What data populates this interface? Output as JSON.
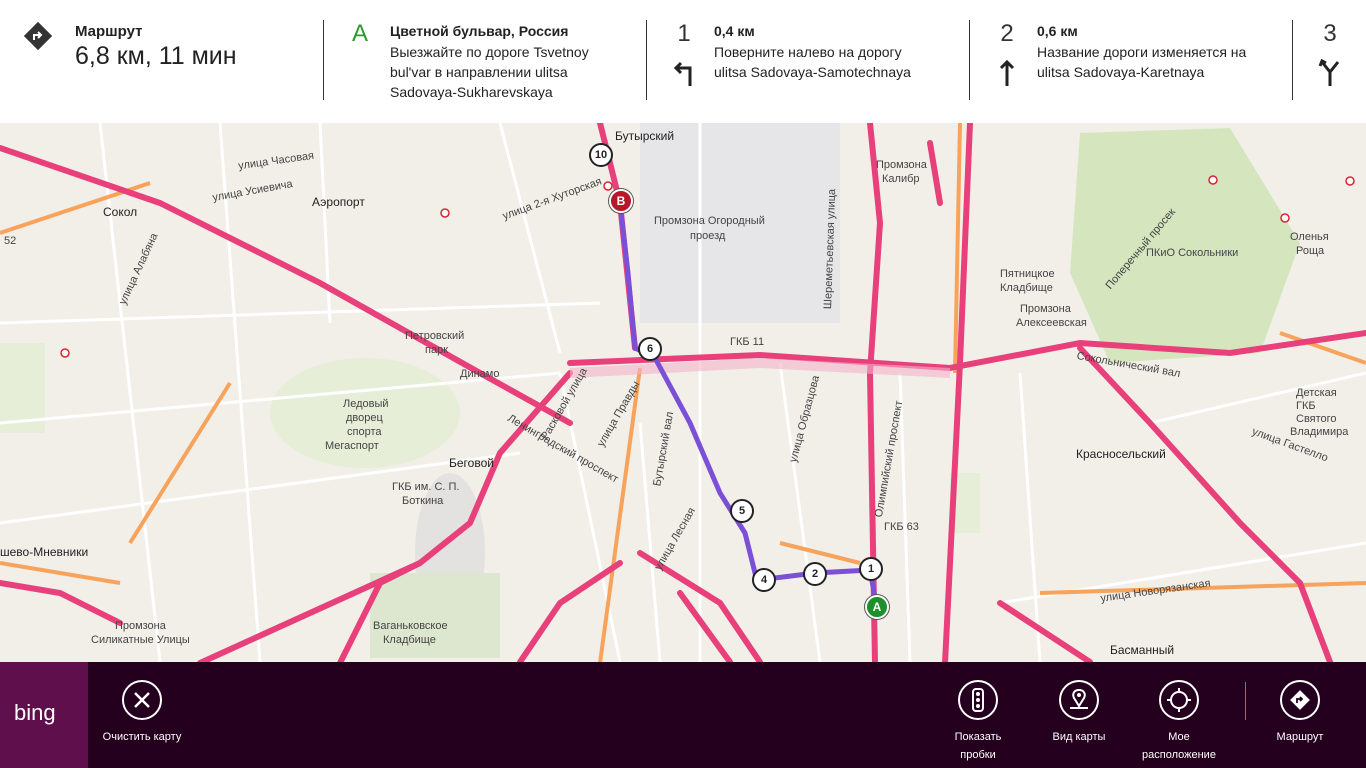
{
  "route_summary": {
    "title": "Маршрут",
    "value": "6,8 км, 11 мин",
    "icon": "route-arrow-icon"
  },
  "steps": [
    {
      "marker": "A",
      "title": "Цветной бульвар, Россия",
      "line1": "Выезжайте по дороге Tsvetnoy",
      "line2": "bul'var в направлении ulitsa",
      "line3": "Sadovaya-Sukharevskaya",
      "icon": ""
    },
    {
      "marker": "1",
      "title": "0,4 км",
      "line1": "Поверните налево на дорогу",
      "line2": "ulitsa Sadovaya-Samotechnaya",
      "line3": "",
      "icon": "turn-left-icon"
    },
    {
      "marker": "2",
      "title": "0,6 км",
      "line1": "Название дороги изменяется на",
      "line2": "ulitsa Sadovaya-Karetnaya",
      "line3": "",
      "icon": "straight-arrow-icon"
    },
    {
      "marker": "3",
      "title": "",
      "line1": "",
      "line2": "",
      "line3": "",
      "icon": "fork-icon"
    }
  ],
  "map": {
    "labels": {
      "butyrsky": "Бутырский",
      "aeroport": "Аэропорт",
      "sokol": "Сокол",
      "promzona_ogorodny": "Промзона Огородный",
      "proezd": "проезд",
      "promzona_kalibr": "Промзона",
      "kalibr": "Калибр",
      "pyatnitskoe": "Пятницкое",
      "kladbishe": "Кладбище",
      "promzona_alekseevskaya": "Промзона",
      "alekseevskaya": "Алексеевская",
      "pkio": "ПКиО Сокольники",
      "olenya": "Оленья",
      "roscha": "Роща",
      "petrovsky": "Петровский",
      "park": "парк",
      "dinamo": "Динамо",
      "ledovy1": "Ледовый",
      "ledovy2": "дворец",
      "ledovy3": "спорта",
      "ledovy4": "Мегаспорт",
      "begovoy": "Беговой",
      "gkb11": "ГКБ 11",
      "gkb63": "ГКБ 63",
      "gkb_botkin1": "ГКБ им. С. П.",
      "gkb_botkin2": "Боткина",
      "krasnoselsky": "Красносельский",
      "basmanny": "Басманный",
      "khoroshevo": "шево-Мневники",
      "vagankovskoe1": "Ваганьковское",
      "vagankovskoe2": "Кладбище",
      "promzona_silikatnye1": "Промзона",
      "promzona_silikatnye2": "Силикатные Улицы",
      "ul_chasovaya": "улица Часовая",
      "ul_usievicha": "улица Усиевича",
      "ul_khutorskaya": "улица 2-я Хуторская",
      "ul_alabyana": "улица Алабяна",
      "ul_novoryazanskaya": "улица Новорязанская",
      "ul_gastello": "улица Гастелло",
      "sokolnichesky_val": "Сокольнический вал",
      "ul_lesnaya": "улица Лесная",
      "ul_pravdy": "улица Правды",
      "ul_obraztsova": "улица Образцова",
      "ul_sheremetyevskaya": "Шереметьевская улица",
      "olimpiysky": "Олимпийский проспект",
      "leningradsky": "Ленинградский проспект",
      "butyrsky_val": "Бутырский вал",
      "raskovoy": "Расковой улица",
      "poperechny": "Поперечный просек",
      "detskaya1": "Детская",
      "detskaya2": "ГКБ",
      "detskaya3": "Святого",
      "detskaya4": "Владимира",
      "km52": "52"
    },
    "markers": [
      "1",
      "2",
      "4",
      "5",
      "6",
      "10"
    ],
    "start_pin": "A",
    "end_pin": "B"
  },
  "appbar": {
    "brand": "bing",
    "clear_map": "Очистить карту",
    "show_traffic_1": "Показать",
    "show_traffic_2": "пробки",
    "map_view": "Вид карты",
    "my_location_1": "Мое",
    "my_location_2": "расположение",
    "route": "Маршрут"
  },
  "colors": {
    "accent_purple": "#25001e",
    "bing_tile": "#5e0f4c",
    "traffic_red": "#e8407a",
    "traffic_orange": "#f7a35c",
    "route_purple": "#7b4fd6",
    "start_green": "#1e8f2a",
    "end_red": "#b5172b"
  }
}
